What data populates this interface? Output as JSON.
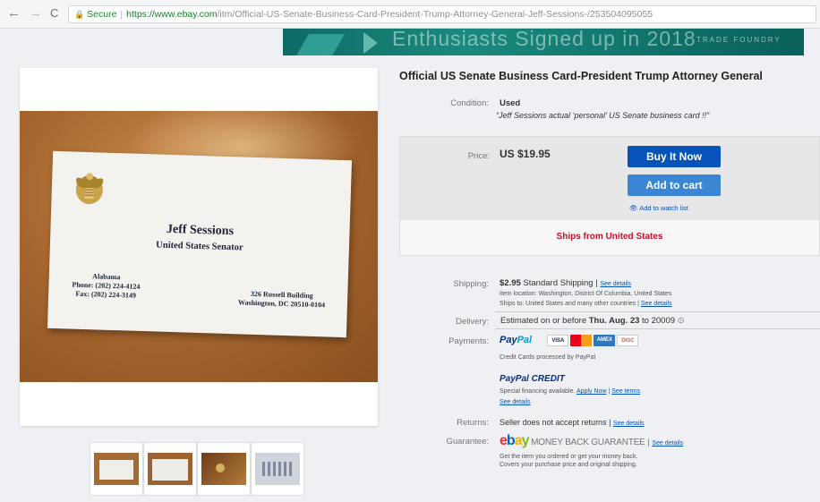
{
  "browser": {
    "back_icon": "←",
    "forward_icon": "→",
    "reload_icon": "C",
    "secure_label": "Secure",
    "url_host": "https://www.ebay.com",
    "url_path": "/itm/Official-US-Senate-Business-Card-President-Trump-Attorney-General-Jeff-Sessions-/253504095055"
  },
  "banner": {
    "text": "Enthusiasts Signed up in 2018",
    "small": "TRADE FOUNDRY"
  },
  "business_card": {
    "name": "Jeff Sessions",
    "title": "United States Senator",
    "state": "Alabama",
    "phone": "Phone: (202) 224-4124",
    "fax": "Fax: (202) 224-3149",
    "address1": "326 Russell Building",
    "address2": "Washington, DC 20510-0104"
  },
  "listing": {
    "title": "Official US Senate Business Card-President Trump Attorney General",
    "condition_label": "Condition:",
    "condition_value": "Used",
    "condition_desc": "“Jeff Sessions actual ‘personal’ US Senate business card !!”",
    "price_label": "Price:",
    "price_value": "US $19.95",
    "buy_now": "Buy It Now",
    "add_to_cart": "Add to cart",
    "watch_list": "Add to watch list",
    "ships_from": "Ships from United States",
    "shipping_label": "Shipping:",
    "shipping_value": "$2.95",
    "shipping_method": "Standard Shipping |",
    "see_details": "See details",
    "item_location": "Item location:  Washington, District Of Columbia, United States",
    "ships_to": "Ships to:  United States and many other countries |",
    "delivery_label": "Delivery:",
    "delivery_prefix": "Estimated on or before",
    "delivery_date": "Thu. Aug. 23",
    "delivery_suffix": "to 20009",
    "payments_label": "Payments:",
    "paypal_1": "Pay",
    "paypal_2": "Pal",
    "credit_processed": "Credit Cards processed by PayPal",
    "paypal_credit": "PayPal CREDIT",
    "special_financing": "Special financing available.",
    "apply_now": "Apply Now",
    "see_terms": "See terms",
    "returns_label": "Returns:",
    "returns_value": "Seller does not accept returns |",
    "guarantee_label": "Guarantee:",
    "guarantee_value": "MONEY BACK GUARANTEE",
    "guarantee_line1": "Get the item you ordered or get your money back.",
    "guarantee_line2": "Covers your purchase price and original shipping."
  },
  "card_brands": [
    "VISA",
    "MC",
    "AMEX",
    "DISC"
  ],
  "colors": {
    "accent_blue": "#0654ba",
    "ships_red": "#c8102e",
    "banner_teal": "#1a8a7e"
  }
}
